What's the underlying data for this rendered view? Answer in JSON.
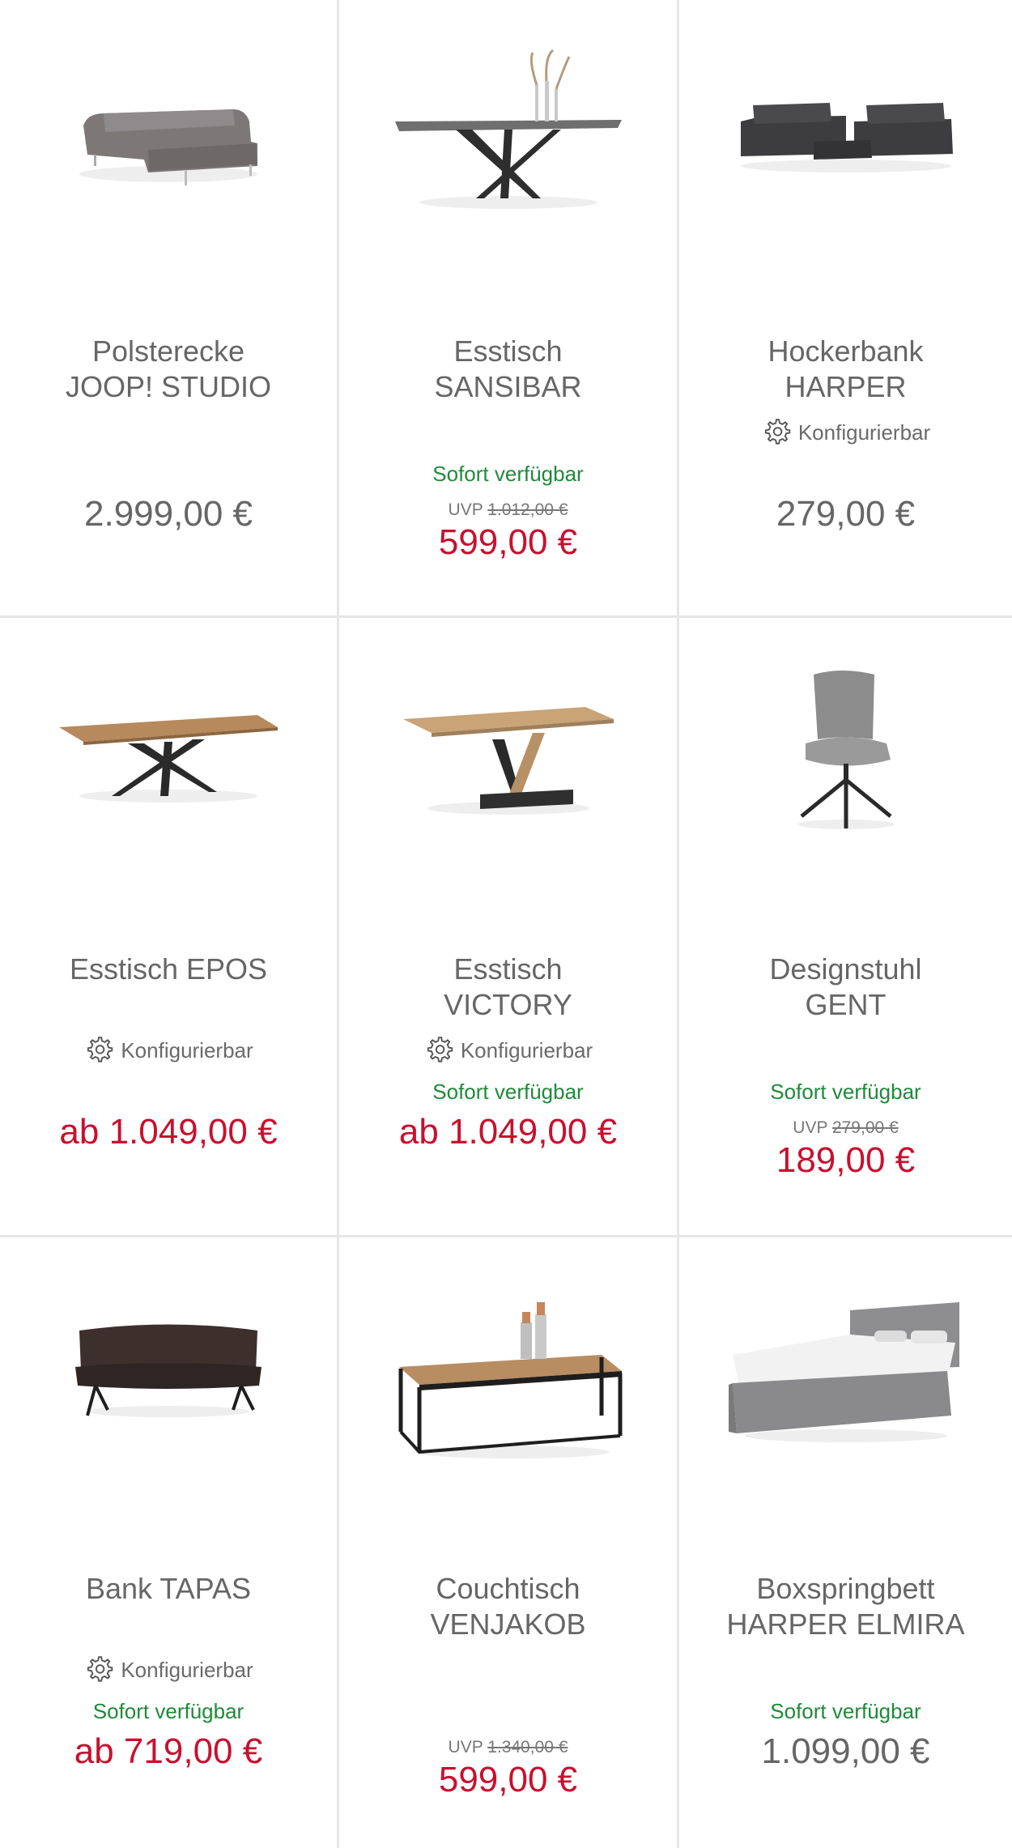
{
  "products": [
    {
      "title1": "Polsterecke",
      "title2": "JOOP! STUDIO",
      "configurable": "",
      "availability": "",
      "uvp_label": "",
      "uvp_value": "",
      "price": "2.999,00 €"
    },
    {
      "title1": "Esstisch",
      "title2": "SANSIBAR",
      "configurable": "",
      "availability": "Sofort verfügbar",
      "uvp_label": "UVP",
      "uvp_value": "1.012,00 €",
      "price": "599,00 €"
    },
    {
      "title1": "Hockerbank",
      "title2": "HARPER",
      "configurable": "Konfigurierbar",
      "availability": "",
      "uvp_label": "",
      "uvp_value": "",
      "price": "279,00 €"
    },
    {
      "title1": "Esstisch EPOS",
      "title2": "",
      "configurable": "Konfigurierbar",
      "availability": "",
      "uvp_label": "",
      "uvp_value": "",
      "price": "ab 1.049,00 €"
    },
    {
      "title1": "Esstisch",
      "title2": "VICTORY",
      "configurable": "Konfigurierbar",
      "availability": "Sofort verfügbar",
      "uvp_label": "",
      "uvp_value": "",
      "price": "ab 1.049,00 €"
    },
    {
      "title1": "Designstuhl",
      "title2": "GENT",
      "configurable": "",
      "availability": "Sofort verfügbar",
      "uvp_label": "UVP",
      "uvp_value": "279,00 €",
      "price": "189,00 €"
    },
    {
      "title1": "Bank TAPAS",
      "title2": "",
      "configurable": "Konfigurierbar",
      "availability": "Sofort verfügbar",
      "uvp_label": "",
      "uvp_value": "",
      "price": "ab 719,00 €"
    },
    {
      "title1": "Couchtisch",
      "title2": "VENJAKOB",
      "configurable": "",
      "availability": "",
      "uvp_label": "UVP",
      "uvp_value": "1.340,00 €",
      "price": "599,00 €"
    },
    {
      "title1": "Boxspringbett",
      "title2": "HARPER ELMIRA",
      "configurable": "",
      "availability": "Sofort verfügbar",
      "uvp_label": "",
      "uvp_value": "",
      "price": "1.099,00 €"
    }
  ],
  "icons": {
    "config": "gear-icon",
    "images": [
      "sofa-image",
      "dining-table-image",
      "sofa-set-image",
      "table-image",
      "table-image",
      "chair-image",
      "bench-image",
      "coffee-table-image",
      "bed-image"
    ]
  },
  "colors": {
    "sale_price": "#c8102e",
    "availability": "#1f8a3a",
    "regular_price": "#666666"
  }
}
